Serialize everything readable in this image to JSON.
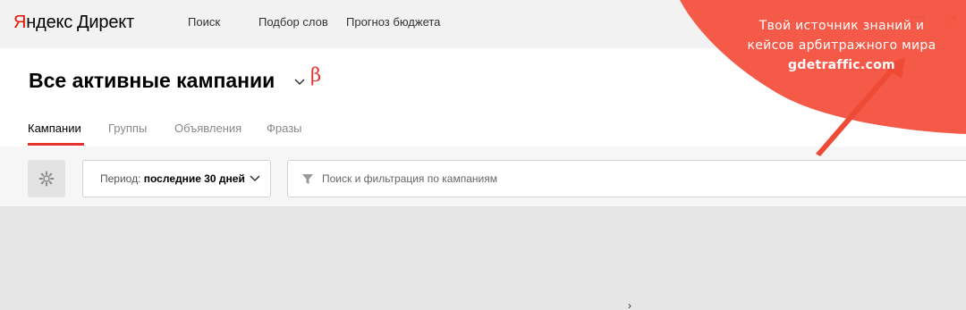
{
  "header": {
    "logo_y": "Я",
    "logo_rest": "ндекс",
    "logo_product": "Директ",
    "nav": [
      "Поиск",
      "Подбор слов",
      "Прогноз бюджета"
    ]
  },
  "page": {
    "title": "Все активные кампании",
    "beta": "β",
    "tabs": [
      {
        "label": "Кампании",
        "active": true
      },
      {
        "label": "Группы",
        "active": false
      },
      {
        "label": "Объявления",
        "active": false
      },
      {
        "label": "Фразы",
        "active": false
      }
    ]
  },
  "toolbar": {
    "period_label": "Период:",
    "period_value": "последние 30 дней",
    "search_placeholder": "Поиск и фильтрация по кампаниям"
  },
  "footer": {
    "chevron": "›"
  },
  "promo": {
    "line1": "Твой источник знаний и",
    "line2": "кейсов арбитражного мира",
    "site": "gdetraffic.com",
    "color": "#f4533f"
  },
  "colors": {
    "accent": "#e5322d",
    "logo_red": "#e61400"
  },
  "icons": [
    "settings-gear-icon",
    "chevron-down-icon",
    "filter-funnel-icon",
    "bell-icon",
    "monitor-icon"
  ]
}
